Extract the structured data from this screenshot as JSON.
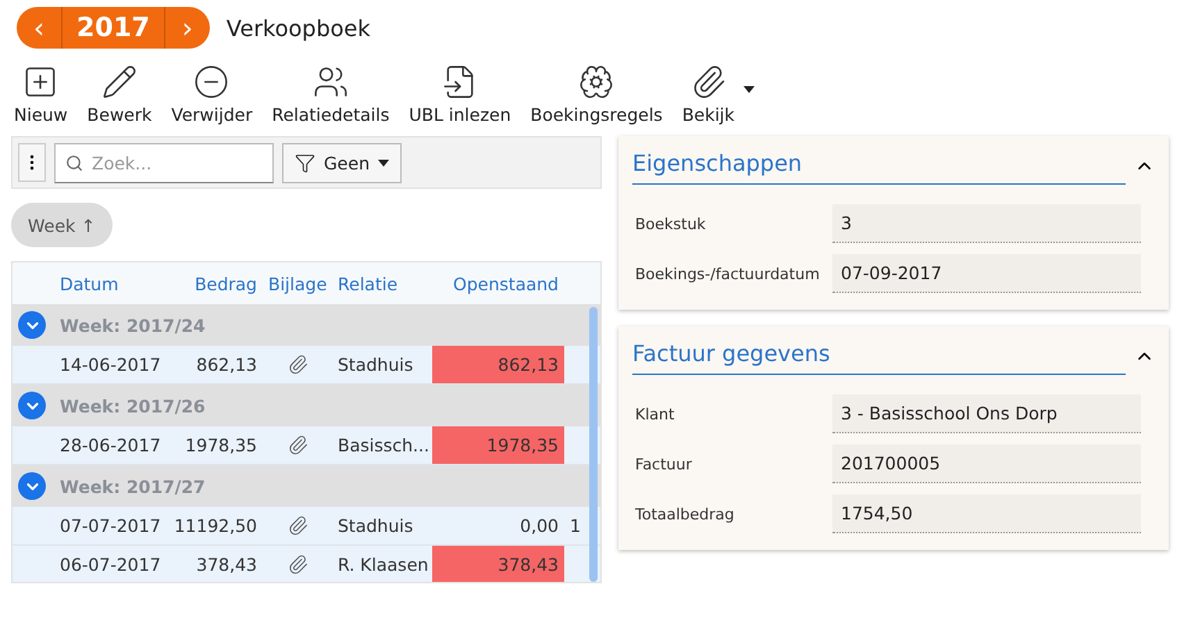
{
  "header": {
    "year": "2017",
    "prev": "‹",
    "next": "›",
    "title": "Verkoopboek"
  },
  "toolbar": [
    {
      "label": "Nieuw",
      "dropdown": false
    },
    {
      "label": "Bewerk",
      "dropdown": false
    },
    {
      "label": "Verwijder",
      "dropdown": false
    },
    {
      "label": "Relatiedetails",
      "dropdown": false
    },
    {
      "label": "UBL inlezen",
      "dropdown": false
    },
    {
      "label": "Boekingsregels",
      "dropdown": false
    },
    {
      "label": "Bekijk",
      "dropdown": true
    }
  ],
  "filter": {
    "search": {
      "placeholder": "Zoek..."
    },
    "filter_button": "Geen"
  },
  "grouping_chip": {
    "label": "Week",
    "arrow": "↑"
  },
  "table": {
    "columns": [
      "Datum",
      "Bedrag",
      "Bijlage",
      "Relatie",
      "Openstaand"
    ],
    "groups": [
      {
        "label": "Week: 2017/24",
        "expanded": true,
        "rows": [
          {
            "datum": "14-06-2017",
            "bedrag": "862,13",
            "relatie": "Stadhuis",
            "openstaand": "862,13",
            "overdue": true
          }
        ]
      },
      {
        "label": "Week: 2017/26",
        "expanded": true,
        "rows": [
          {
            "datum": "28-06-2017",
            "bedrag": "1978,35",
            "relatie": "Basissch...",
            "openstaand": "1978,35",
            "overdue": true
          }
        ]
      },
      {
        "label": "Week: 2017/27",
        "expanded": true,
        "rows": [
          {
            "datum": "07-07-2017",
            "bedrag": "11192,50",
            "relatie": "Stadhuis",
            "openstaand": "0,00",
            "overdue": false,
            "column_6": "1"
          },
          {
            "datum": "06-07-2017",
            "bedrag": "378,43",
            "relatie": "R. Klaasen",
            "openstaand": "378,43",
            "overdue": true
          }
        ]
      }
    ]
  },
  "cards": [
    {
      "title": "Eigenschappen",
      "expanded": true,
      "fields": [
        {
          "label": "Boekstuk",
          "value": "3"
        },
        {
          "label": "Boekings-/factuurdatum",
          "value": "07-09-2017"
        }
      ]
    },
    {
      "title": "Factuur gegevens",
      "expanded": true,
      "fields": [
        {
          "label": "Klant",
          "value": "3 - Basisschool Ons Dorp"
        },
        {
          "label": "Factuur",
          "value": "201700005"
        },
        {
          "label": "Totaalbedrag",
          "value": "1754,50"
        }
      ]
    }
  ]
}
